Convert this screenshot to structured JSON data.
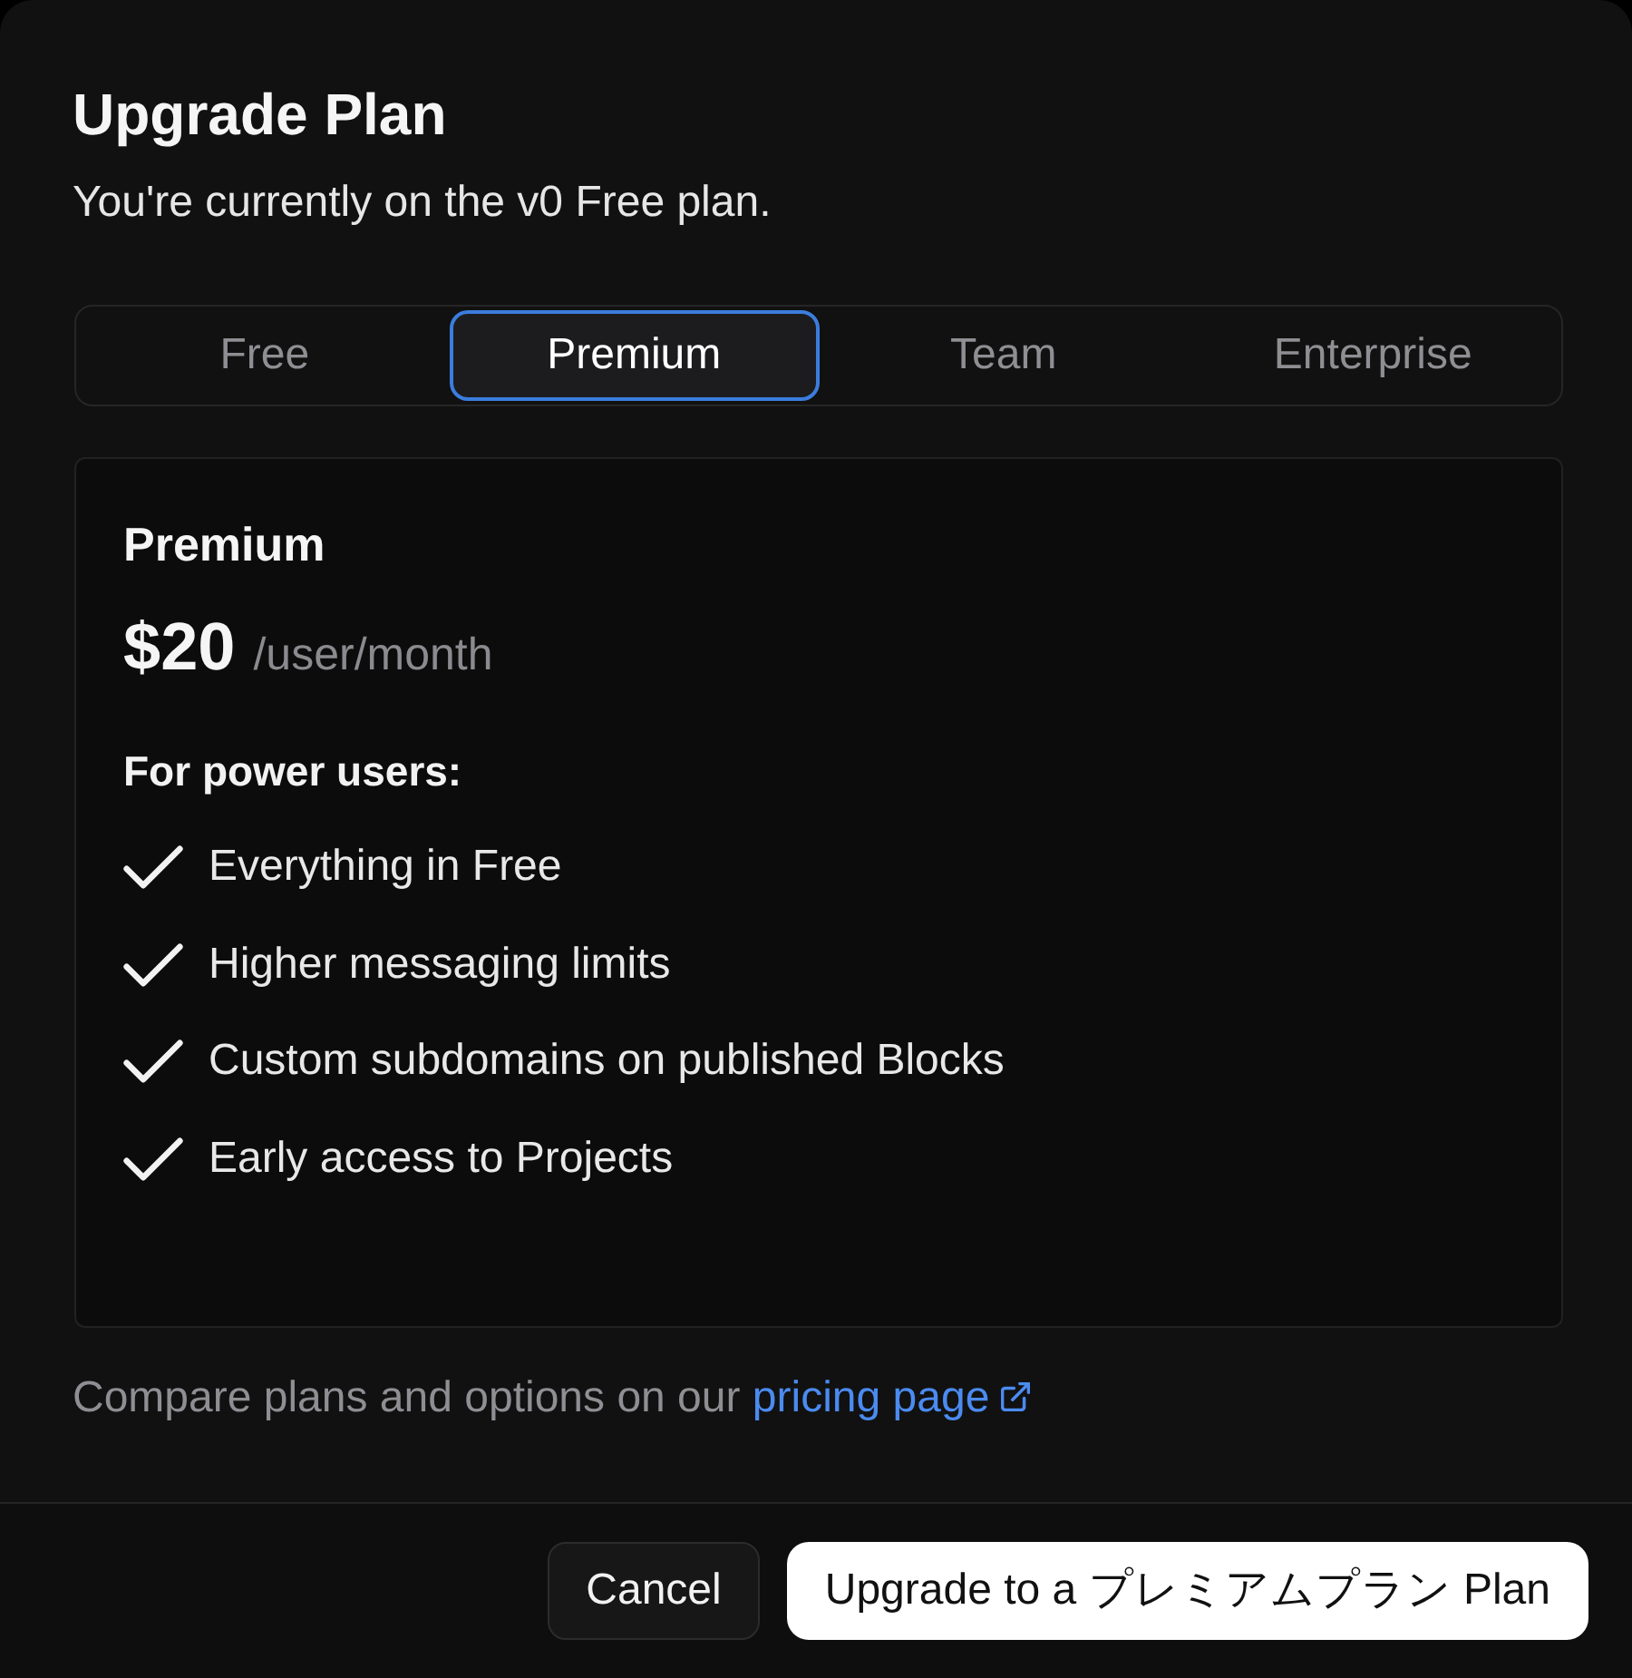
{
  "dialog": {
    "title": "Upgrade Plan",
    "subtitle": "You're currently on the v0 Free plan."
  },
  "tabs": [
    {
      "label": "Free",
      "selected": false
    },
    {
      "label": "Premium",
      "selected": true
    },
    {
      "label": "Team",
      "selected": false
    },
    {
      "label": "Enterprise",
      "selected": false
    }
  ],
  "plan_card": {
    "name": "Premium",
    "price": "$20",
    "period": "/user/month",
    "features_heading": "For power users:",
    "features": [
      "Everything in Free",
      "Higher messaging limits",
      "Custom subdomains on published Blocks",
      "Early access to Projects"
    ]
  },
  "footer_note": {
    "text": "Compare plans and options on our",
    "link": "pricing page"
  },
  "buttons": [
    {
      "label": "Cancel",
      "kind": "secondary"
    },
    {
      "label": "Upgrade to a プレミアムプラン Plan",
      "kind": "primary"
    }
  ]
}
